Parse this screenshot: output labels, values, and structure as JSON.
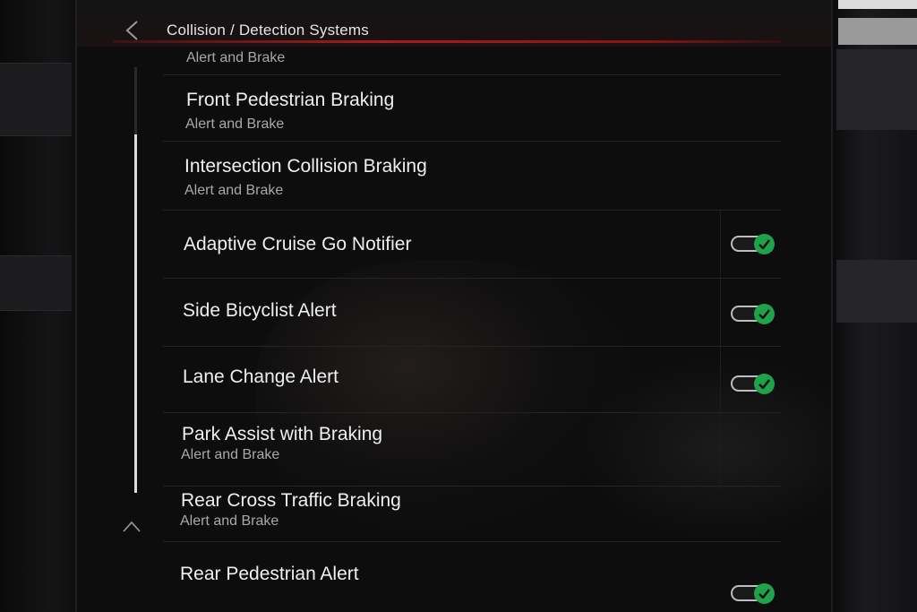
{
  "header": {
    "title": "Collision / Detection Systems"
  },
  "list": {
    "items": [
      {
        "label": "",
        "sublabel": "Alert and Brake",
        "has_toggle": false
      },
      {
        "label": "Front Pedestrian Braking",
        "sublabel": "Alert and Brake",
        "has_toggle": false
      },
      {
        "label": "Intersection Collision Braking",
        "sublabel": "Alert and Brake",
        "has_toggle": false
      },
      {
        "label": "Adaptive Cruise Go Notifier",
        "sublabel": "",
        "has_toggle": true,
        "toggle_on": true
      },
      {
        "label": "Side Bicyclist Alert",
        "sublabel": "",
        "has_toggle": true,
        "toggle_on": true
      },
      {
        "label": "Lane Change Alert",
        "sublabel": "",
        "has_toggle": true,
        "toggle_on": true
      },
      {
        "label": "Park Assist with Braking",
        "sublabel": "Alert and Brake",
        "has_toggle": false
      },
      {
        "label": "Rear Cross Traffic Braking",
        "sublabel": "Alert and Brake",
        "has_toggle": false
      },
      {
        "label": "Rear Pedestrian Alert",
        "sublabel": "",
        "has_toggle": true,
        "toggle_on": true
      }
    ]
  },
  "colors": {
    "accent_red": "#a81c1c",
    "toggle_on": "#1fa24a",
    "text_primary": "#efefef",
    "text_secondary": "#a9a9ab"
  },
  "icons": {
    "back": "chevron-left-icon",
    "scroll_up": "chevron-up-icon",
    "toggle_check": "check-icon"
  }
}
